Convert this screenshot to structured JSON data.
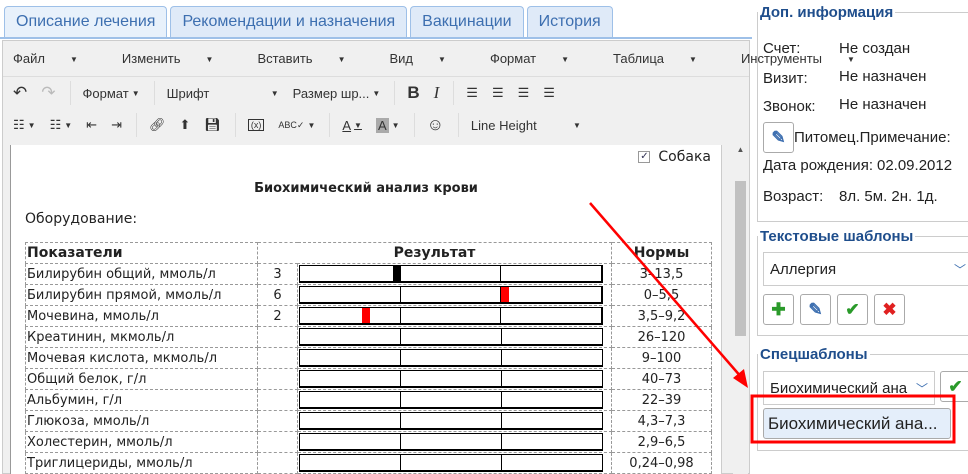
{
  "tabs": [
    "Описание лечения",
    "Рекомендации и назначения",
    "Вакцинации",
    "История"
  ],
  "menu": [
    "Файл",
    "Изменить",
    "Вставить",
    "Вид",
    "Формат",
    "Таблица",
    "Инструменты"
  ],
  "toolbar": {
    "format": "Формат",
    "font": "Шрифт",
    "size": "Размер шр...",
    "line_height": "Line Height",
    "bold": "B",
    "italic": "I"
  },
  "doc": {
    "checkbox_label": "Собака",
    "title": "Биохимический анализ крови",
    "equipment": "Оборудование:",
    "headers": [
      "Показатели",
      "Результат",
      "Нормы"
    ],
    "rows": [
      {
        "name": "Билирубин общий, ммоль/л",
        "value": "3",
        "norm": "3–13,5",
        "marker": 0.32,
        "marker_color": "#000000"
      },
      {
        "name": "Билирубин прямой, ммоль/л",
        "value": "6",
        "norm": "0–5,5",
        "marker": 0.68,
        "marker_color": "#ff0000"
      },
      {
        "name": "Мочевина, ммоль/л",
        "value": "2",
        "norm": "3,5–9,2",
        "marker": 0.22,
        "marker_color": "#ff0000"
      },
      {
        "name": "Креатинин, мкмоль/л",
        "value": "",
        "norm": "26–120"
      },
      {
        "name": "Мочевая кислота, мкмоль/л",
        "value": "",
        "norm": "9–100"
      },
      {
        "name": "Общий белок, г/л",
        "value": "",
        "norm": "40–73"
      },
      {
        "name": "Альбумин, г/л",
        "value": "",
        "norm": "22–39"
      },
      {
        "name": "Глюкоза, ммоль/л",
        "value": "",
        "norm": "4,3–7,3"
      },
      {
        "name": "Холестерин, ммоль/л",
        "value": "",
        "norm": "2,9–6,5"
      },
      {
        "name": "Триглицериды, ммоль/л",
        "value": "",
        "norm": "0,24–0,98"
      }
    ]
  },
  "info": {
    "legend": "Доп. информация",
    "account_k": "Счет:",
    "account_v": "Не создан",
    "visit_k": "Визит:",
    "visit_v": "Не назначен",
    "call_k": "Звонок:",
    "call_v": "Не назначен",
    "note": "Питомец.Примечание:",
    "birth_k": "Дата рождения:",
    "birth_v": "02.09.2012",
    "age_k": "Возраст:",
    "age_v": "8л. 5м. 2н. 1д."
  },
  "templates": {
    "legend": "Текстовые шаблоны",
    "selected": "Аллергия"
  },
  "special": {
    "legend": "Спецшаблоны",
    "selected": "Биохимический ана",
    "button": "Биохимический ана..."
  }
}
